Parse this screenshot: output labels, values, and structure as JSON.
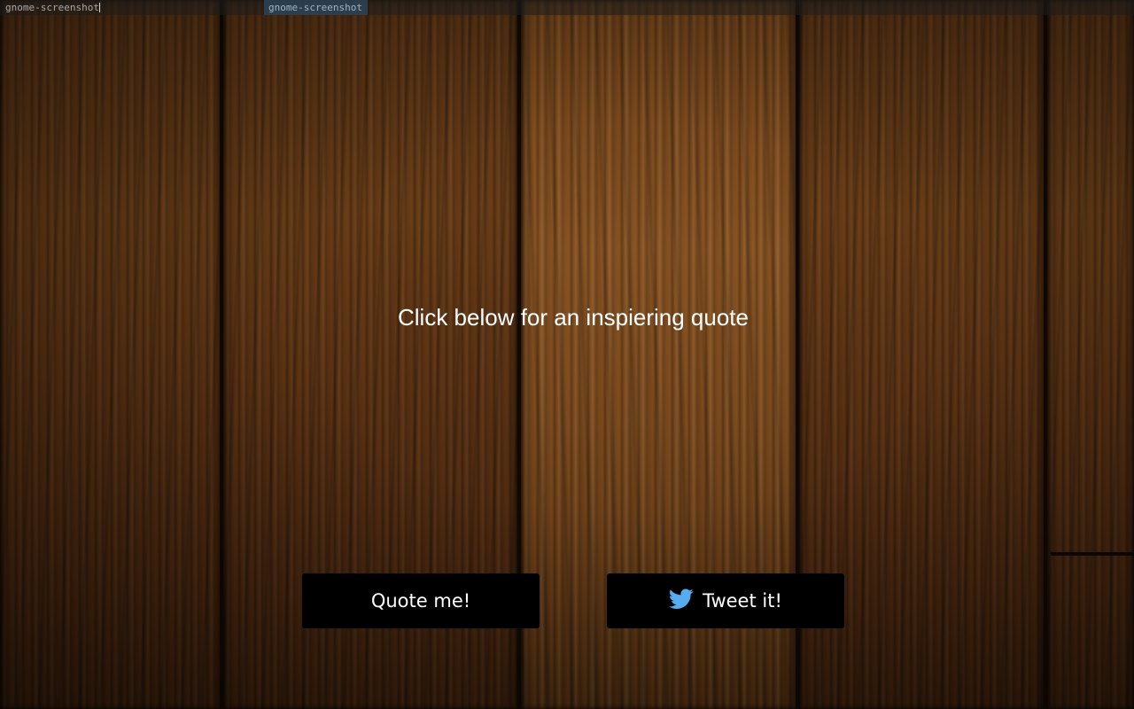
{
  "taskbar": {
    "left_task": "gnome-screenshot",
    "active_task": "gnome-screenshot"
  },
  "main": {
    "prompt": "Click below for an inspiering quote",
    "quote_button": "Quote me!",
    "tweet_button": "Tweet it!",
    "tweet_icon": "twitter-bird-icon"
  },
  "colors": {
    "button_bg": "#000000",
    "button_text": "#ffffff",
    "twitter_blue": "#55acee"
  }
}
